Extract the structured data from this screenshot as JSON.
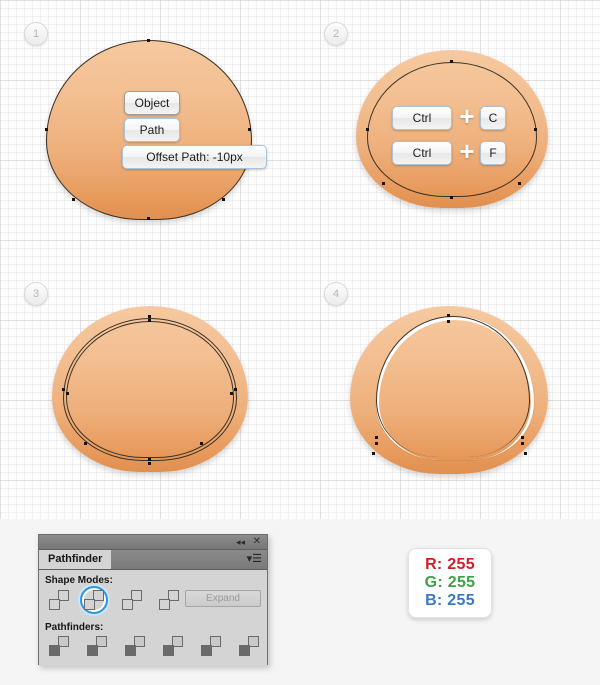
{
  "steps": [
    {
      "number": "1"
    },
    {
      "number": "2"
    },
    {
      "number": "3"
    },
    {
      "number": "4"
    }
  ],
  "step1": {
    "menu_buttons": [
      {
        "label": "Object"
      },
      {
        "label": "Path"
      },
      {
        "label": "Offset Path: -10px"
      }
    ]
  },
  "step2": {
    "shortcuts": [
      {
        "modifier": "Ctrl",
        "plus": "+",
        "key": "C"
      },
      {
        "modifier": "Ctrl",
        "plus": "+",
        "key": "F"
      }
    ]
  },
  "pathfinder": {
    "title": "Pathfinder",
    "collapse_icon": "◂◂",
    "close_icon": "✕",
    "menu_icon": "▾☰",
    "shape_modes_label": "Shape Modes:",
    "pathfinders_label": "Pathfinders:",
    "expand_label": "Expand",
    "shape_modes": [
      {
        "name": "unite"
      },
      {
        "name": "minus-front"
      },
      {
        "name": "intersect"
      },
      {
        "name": "exclude"
      }
    ],
    "selected_shape_mode_index": 1,
    "pathfinders": [
      {
        "name": "divide"
      },
      {
        "name": "trim"
      },
      {
        "name": "merge"
      },
      {
        "name": "crop"
      },
      {
        "name": "outline"
      },
      {
        "name": "minus-back"
      }
    ]
  },
  "rgb_swatch": {
    "r": "R: 255",
    "g": "G: 255",
    "b": "B: 255",
    "r_color": "#cf2026",
    "g_color": "#3ba247",
    "b_color": "#3b78c3"
  },
  "colors": {
    "shape_light": "#f6c9a0",
    "shape_dark": "#e08f4e",
    "accent_blue": "#2e96e0",
    "panel_bg": "#d4d4d4",
    "canvas_bg": "#fbfbfb"
  }
}
